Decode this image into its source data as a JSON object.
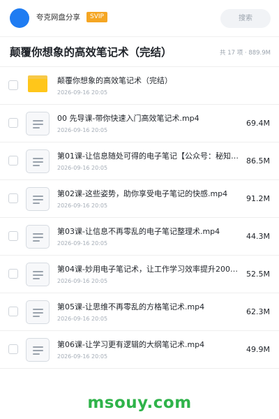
{
  "header": {
    "user_name": "夸克网盘分享",
    "badge": "SVIP",
    "search_placeholder": "搜索",
    "avatar_color": "#1f7cf2",
    "badge_color": "#f5a623"
  },
  "folder": {
    "title": "颠覆你想象的高效笔记术（完结）",
    "summary": "共 17 项 · 889.9M"
  },
  "items": [
    {
      "type": "folder",
      "icon": "folder-icon",
      "name": "颠覆你想象的高效笔记术（完结）",
      "date": "2026-09-16 20:05",
      "size": ""
    },
    {
      "type": "file",
      "icon": "document-icon",
      "name": "00 先导课-带你快速入门高效笔记术.mp4",
      "date": "2026-09-16 20:05",
      "size": "69.4M"
    },
    {
      "type": "file",
      "icon": "document-icon",
      "name": "第01课-让信息随处可得的电子笔记【公众号：秘知圈…",
      "date": "2026-09-16 20:05",
      "size": "86.5M"
    },
    {
      "type": "file",
      "icon": "document-icon",
      "name": "第02课-这些姿势，助你享受电子笔记的快感.mp4",
      "date": "2026-09-16 20:05",
      "size": "91.2M"
    },
    {
      "type": "file",
      "icon": "document-icon",
      "name": "第03课-让信息不再零乱的电子笔记整理术.mp4",
      "date": "2026-09-16 20:05",
      "size": "44.3M"
    },
    {
      "type": "file",
      "icon": "document-icon",
      "name": "第04课-妙用电子笔记术，让工作学习效率提升200…",
      "date": "2026-09-16 20:05",
      "size": "52.5M"
    },
    {
      "type": "file",
      "icon": "document-icon",
      "name": "第05课-让思维不再零乱的方格笔记术.mp4",
      "date": "2026-09-16 20:05",
      "size": "62.3M"
    },
    {
      "type": "file",
      "icon": "document-icon",
      "name": "第06课-让学习更有逻辑的大纲笔记术.mp4",
      "date": "2026-09-16 20:05",
      "size": "49.9M"
    }
  ],
  "watermark": "msouy.com",
  "watermark_color": "#2fb34a"
}
